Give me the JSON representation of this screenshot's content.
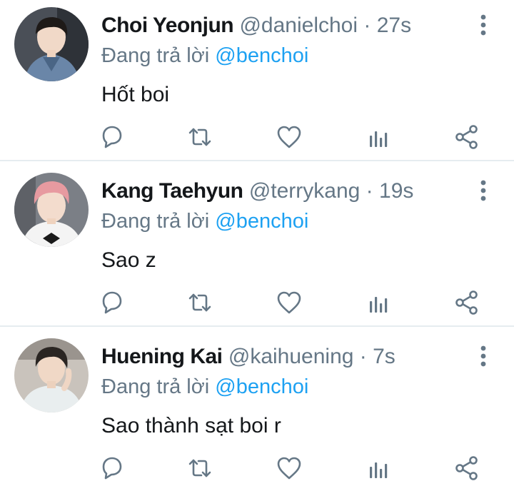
{
  "colors": {
    "text": "#14171a",
    "secondary": "#657786",
    "mention": "#1da1f2",
    "divider": "#e6ecf0"
  },
  "tweets": [
    {
      "name": "Choi Yeonjun",
      "handle": "@danielchoi",
      "separator": "·",
      "time": "27s",
      "reply_prefix": "Đang trả lời",
      "reply_to": "@benchoi",
      "text": "Hốt boi",
      "avatar_icon": "profile-photo"
    },
    {
      "name": "Kang Taehyun",
      "handle": "@terrykang",
      "separator": "·",
      "time": "19s",
      "reply_prefix": "Đang trả lời",
      "reply_to": "@benchoi",
      "text": "Sao z",
      "avatar_icon": "profile-photo"
    },
    {
      "name": "Huening Kai",
      "handle": "@kaihuening",
      "separator": "·",
      "time": "7s",
      "reply_prefix": "Đang trả lời",
      "reply_to": "@benchoi",
      "text": "Sao thành sạt boi r",
      "avatar_icon": "profile-photo"
    }
  ],
  "actions": [
    "reply-icon",
    "retweet-icon",
    "like-icon",
    "analytics-icon",
    "share-icon"
  ]
}
